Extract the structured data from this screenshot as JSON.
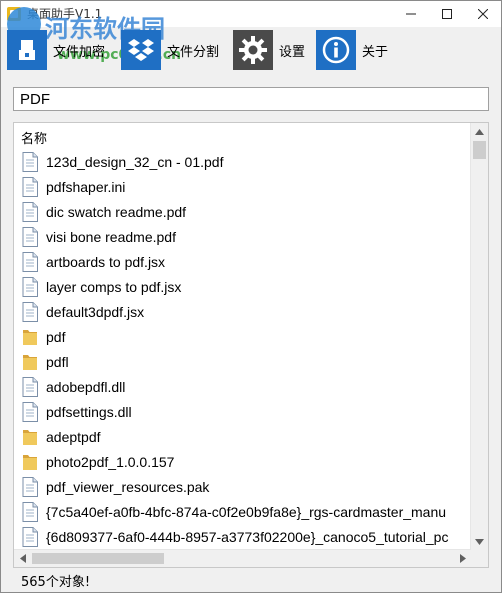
{
  "window": {
    "title": "桌面助手V1.1",
    "controls": [
      "minimize",
      "maximize",
      "close"
    ]
  },
  "watermark": {
    "text": "河东软件园",
    "url": "www.pc0359.cn"
  },
  "toolbar": {
    "buttons": [
      {
        "label": "文件加密",
        "icon": "file-encrypt-icon",
        "color": "#1f6fc4"
      },
      {
        "label": "文件分割",
        "icon": "dropbox-split-icon",
        "color": "#1f6fc4"
      },
      {
        "label": "设置",
        "icon": "gear-icon",
        "color": "#4a4a4a"
      },
      {
        "label": "关于",
        "icon": "info-icon",
        "color": "#1f6fc4"
      }
    ]
  },
  "search": {
    "value": "PDF"
  },
  "list": {
    "column_header": "名称",
    "items": [
      {
        "name": "123d_design_32_cn - 01.pdf",
        "type": "file"
      },
      {
        "name": "pdfshaper.ini",
        "type": "file"
      },
      {
        "name": "dic swatch readme.pdf",
        "type": "file"
      },
      {
        "name": "visi bone readme.pdf",
        "type": "file"
      },
      {
        "name": "artboards to pdf.jsx",
        "type": "file"
      },
      {
        "name": "layer comps to pdf.jsx",
        "type": "file"
      },
      {
        "name": "default3dpdf.jsx",
        "type": "file"
      },
      {
        "name": "pdf",
        "type": "folder"
      },
      {
        "name": "pdfl",
        "type": "folder"
      },
      {
        "name": "adobepdfl.dll",
        "type": "file"
      },
      {
        "name": "pdfsettings.dll",
        "type": "file"
      },
      {
        "name": "adeptpdf",
        "type": "folder"
      },
      {
        "name": "photo2pdf_1.0.0.157",
        "type": "folder"
      },
      {
        "name": "pdf_viewer_resources.pak",
        "type": "file"
      },
      {
        "name": "{7c5a40ef-a0fb-4bfc-874a-c0f2e0b9fa8e}_rgs-cardmaster_manu",
        "type": "file"
      },
      {
        "name": "{6d809377-6af0-444b-8957-a3773f02200e}_canoco5_tutorial_pc",
        "type": "file"
      }
    ]
  },
  "status": {
    "text": "565个对象!"
  },
  "colors": {
    "accent_blue": "#1f6fc4",
    "folder_yellow": "#e8b84a",
    "gear_gray": "#4a4a4a"
  }
}
